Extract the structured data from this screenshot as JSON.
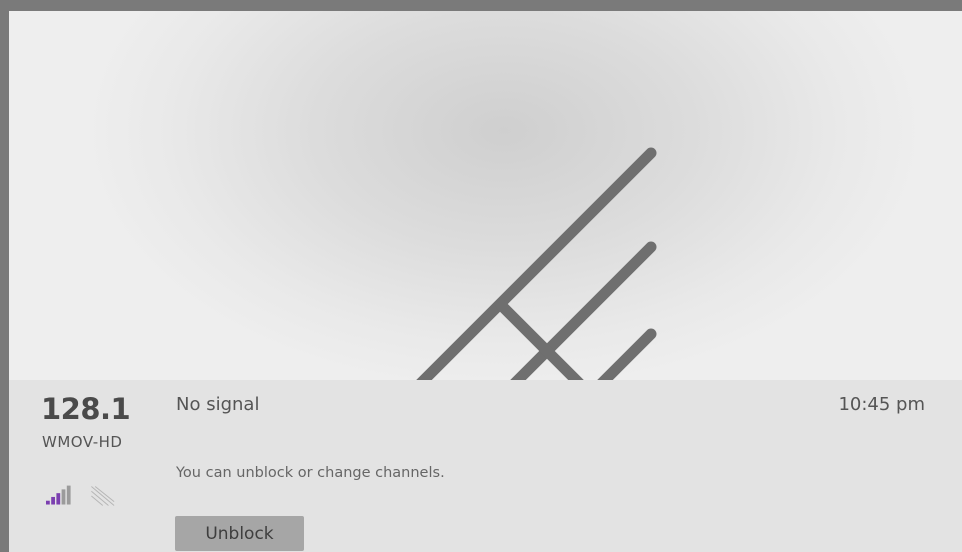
{
  "channel": {
    "number": "128.1",
    "name": "WMOV-HD"
  },
  "status": {
    "title": "No signal",
    "time": "10:45 pm",
    "message": "You can unblock or change channels."
  },
  "actions": {
    "unblock_label": "Unblock"
  },
  "signal": {
    "bars_filled": 3,
    "bars_total": 5,
    "icon": "signal-strength-icon",
    "antenna_icon": "antenna-icon"
  },
  "colors": {
    "signal_active": "#7b3fb0",
    "signal_inactive": "#9b9b9b",
    "panel_background": "#e3e3e3",
    "frame": "#7a7a7a"
  }
}
